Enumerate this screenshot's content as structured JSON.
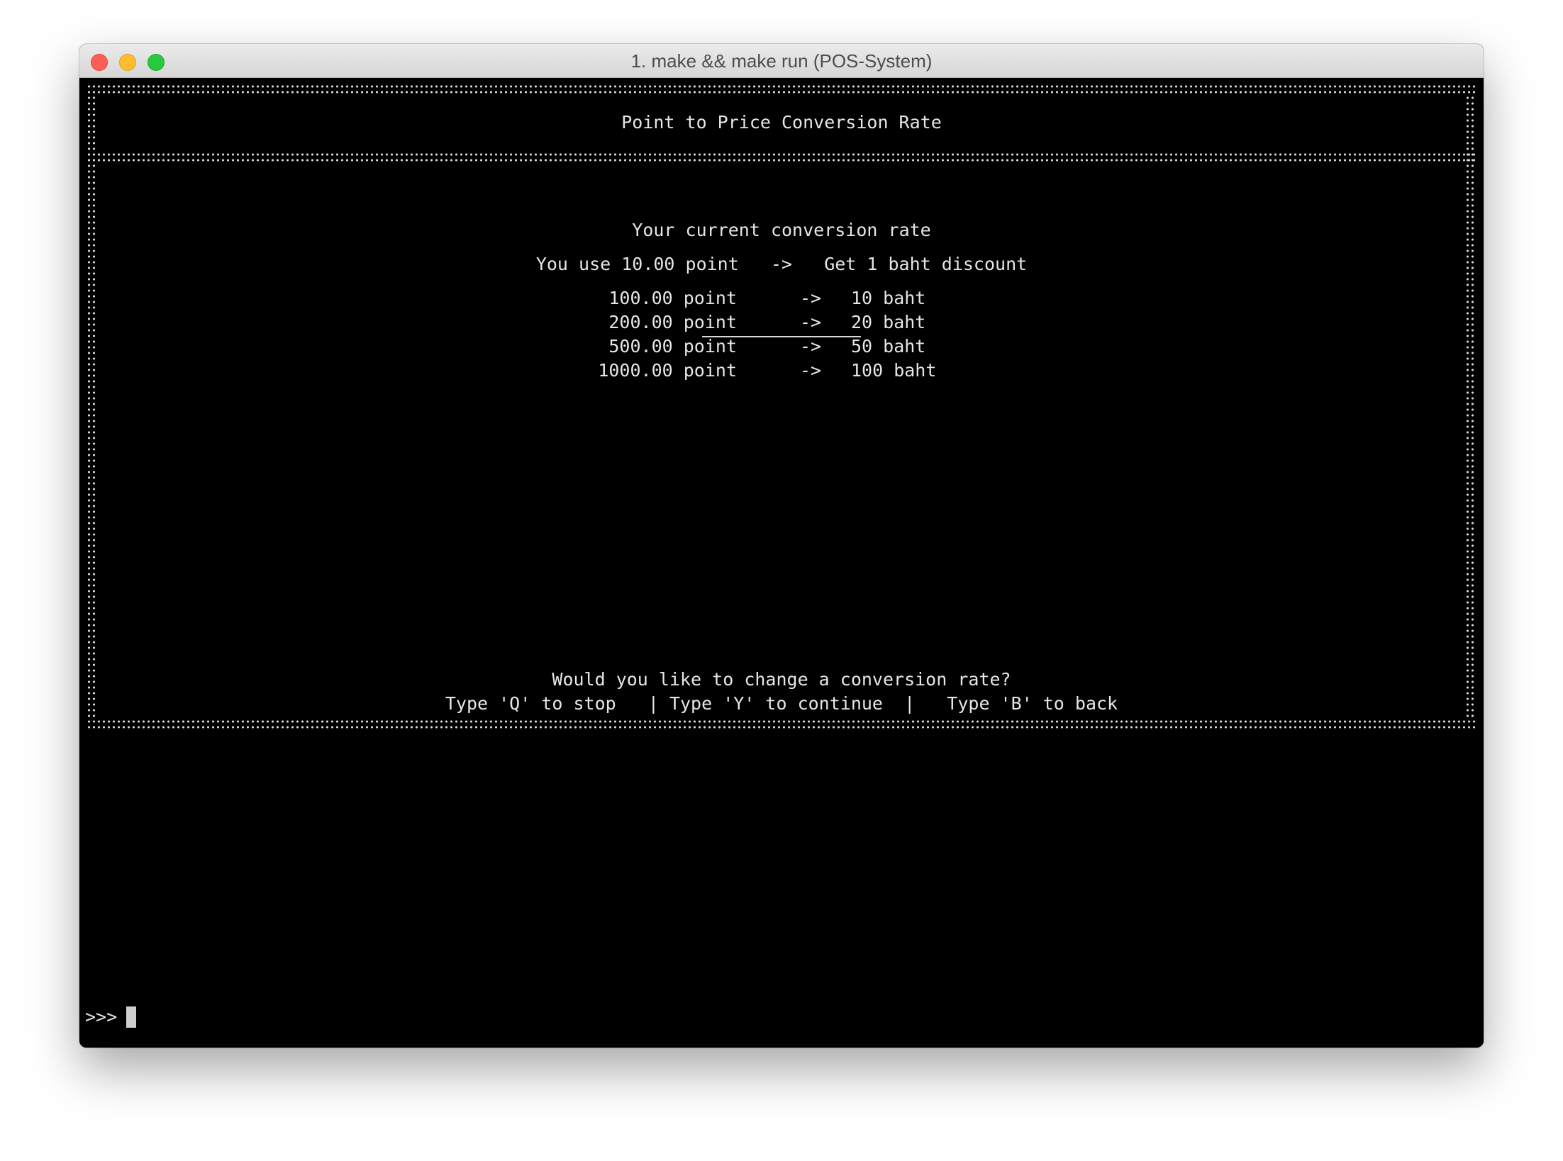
{
  "window": {
    "title": "1. make && make run (POS-System)"
  },
  "header": {
    "title": "Point to Price Conversion Rate"
  },
  "body": {
    "current_label": "Your current conversion rate",
    "rate_line": "You use 10.00 point   ->   Get 1 baht discount",
    "arrow": "->",
    "rates": [
      {
        "points": "100.00 point",
        "baht": "10 baht"
      },
      {
        "points": "200.00 point",
        "baht": "20 baht"
      },
      {
        "points": "500.00 point",
        "baht": "50 baht"
      },
      {
        "points": "1000.00 point",
        "baht": "100 baht"
      }
    ]
  },
  "footer": {
    "question": "Would you like to change a conversion rate?",
    "options": "Type 'Q' to stop   | Type 'Y' to continue  |   Type 'B' to back"
  },
  "prompt": {
    "symbol": ">>>"
  },
  "colors": {
    "background": "#000000",
    "text": "#e6e6e6",
    "close": "#fd5f57",
    "minimize": "#febc2e",
    "maximize": "#28c840"
  }
}
